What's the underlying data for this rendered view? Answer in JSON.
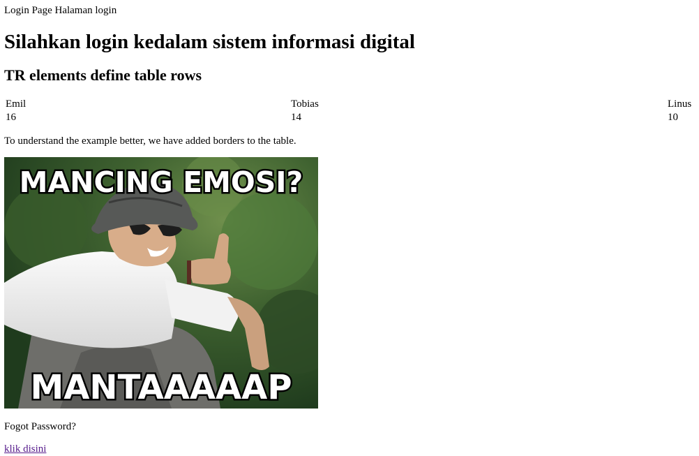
{
  "header": {
    "intro": "Login Page Halaman login"
  },
  "title": "Silahkan login kedalam sistem informasi digital",
  "subtitle": "TR elements define table rows",
  "table": {
    "rows": [
      [
        "Emil",
        "Tobias",
        "Linus"
      ],
      [
        "16",
        "14",
        "10"
      ]
    ]
  },
  "note": "To understand the example better, we have added borders to the table.",
  "meme": {
    "top_text": "MANCING EMOSI?",
    "bottom_text": "MANTAAAAAP"
  },
  "forgot": "Fogot Password?",
  "link_text": "klik disini",
  "colors": {
    "link_visited": "#551a8b"
  }
}
